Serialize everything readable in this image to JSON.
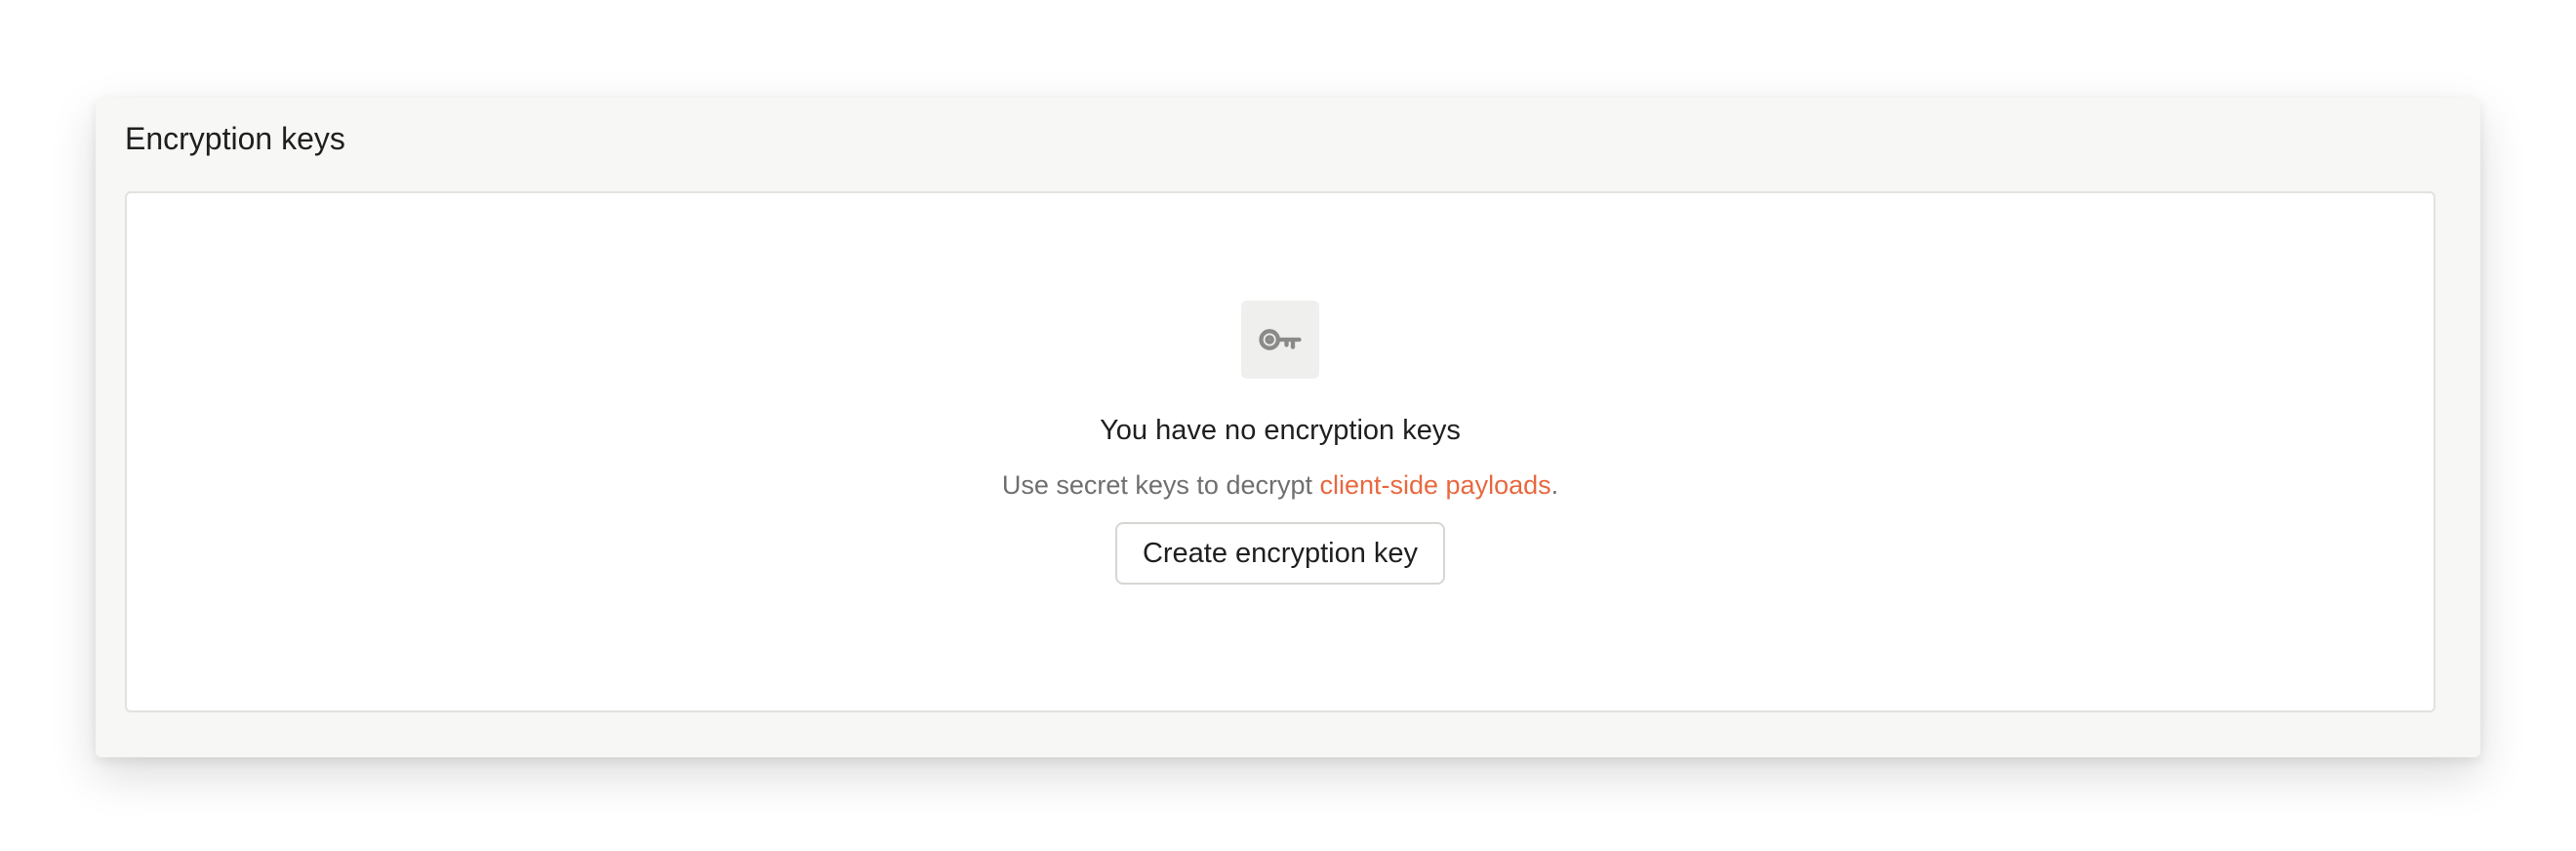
{
  "panel": {
    "title": "Encryption keys"
  },
  "empty_state": {
    "icon": "key-icon",
    "title": "You have no encryption keys",
    "description_prefix": "Use secret keys to decrypt ",
    "description_link": "client-side payloads",
    "description_suffix": ".",
    "button_label": "Create encryption key"
  },
  "colors": {
    "link": "#e8683f",
    "icon": "#8a8a88"
  }
}
